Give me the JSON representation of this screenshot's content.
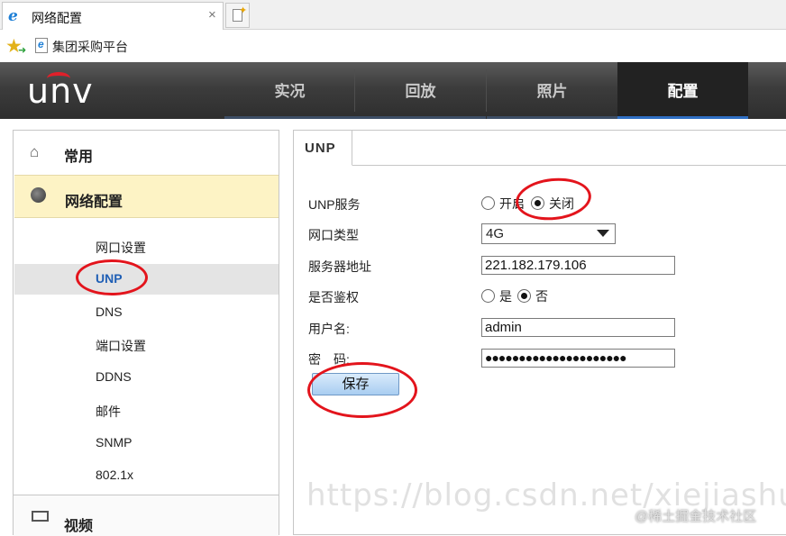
{
  "browser": {
    "tab_title": "网络配置",
    "tab_close": "×",
    "favorite_label": "集团采购平台"
  },
  "header": {
    "logo": "UNV",
    "nav": [
      {
        "label": "实况",
        "active": false
      },
      {
        "label": "回放",
        "active": false
      },
      {
        "label": "照片",
        "active": false
      },
      {
        "label": "配置",
        "active": true
      }
    ]
  },
  "sidebar": {
    "top_item": "常用",
    "group_label": "网络配置",
    "sub_items": [
      "网口设置",
      "UNP",
      "DNS",
      "端口设置",
      "DDNS",
      "邮件",
      "SNMP",
      "802.1x"
    ],
    "selected": "UNP",
    "bottom_item": "视频"
  },
  "panel": {
    "tab": "UNP",
    "fields": {
      "unp_service": {
        "label": "UNP服务",
        "options": [
          "开启",
          "关闭"
        ],
        "selected": "关闭"
      },
      "port_type": {
        "label": "网口类型",
        "value": "4G"
      },
      "server_address": {
        "label": "服务器地址",
        "value": "221.182.179.106"
      },
      "auth": {
        "label": "是否鉴权",
        "options": [
          "是",
          "否"
        ],
        "selected": "否"
      },
      "username": {
        "label": "用户名:",
        "value": "admin"
      },
      "password": {
        "label": "密　码:",
        "value": "●●●●●●●●●●●●●●●●●●●●●"
      }
    },
    "save_label": "保存"
  },
  "overlay": {
    "watermark": "https://blog.csdn.net/xiejiashu",
    "credit": "@稀土掘金技术社区"
  },
  "colors": {
    "header_bg": "#333333",
    "active_nav_accent": "#2f6fc4",
    "group_highlight": "#fdf3c5",
    "selected_link": "#1f5fb5",
    "annotation_red": "#e3141c"
  }
}
